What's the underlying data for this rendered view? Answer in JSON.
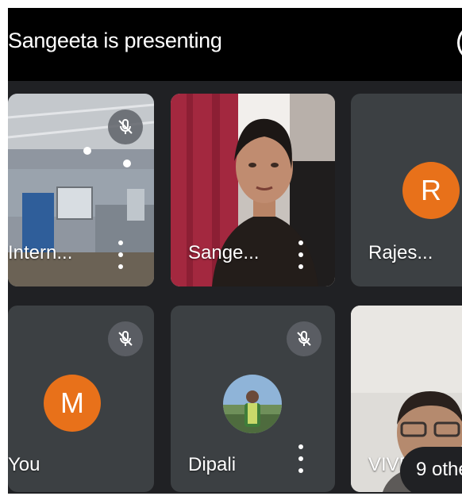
{
  "header": {
    "presenting_text": "Sangeeta is presenting"
  },
  "tiles": [
    {
      "name": "Intern...",
      "muted": true
    },
    {
      "name": "Sange...",
      "muted": false
    },
    {
      "name": "Rajes...",
      "avatar_letter": "R",
      "muted": false
    },
    {
      "name": "You",
      "avatar_letter": "M",
      "muted": true
    },
    {
      "name": "Dipali",
      "muted": true
    },
    {
      "name": "VIVEK"
    }
  ],
  "overflow": {
    "label": "9 othe"
  },
  "colors": {
    "background": "#202124",
    "tile": "#3c4043",
    "avatar_orange": "#e8711a",
    "topbar": "#000000"
  },
  "icons": [
    "mic-off-icon",
    "more-vert-icon",
    "profile-photo"
  ]
}
